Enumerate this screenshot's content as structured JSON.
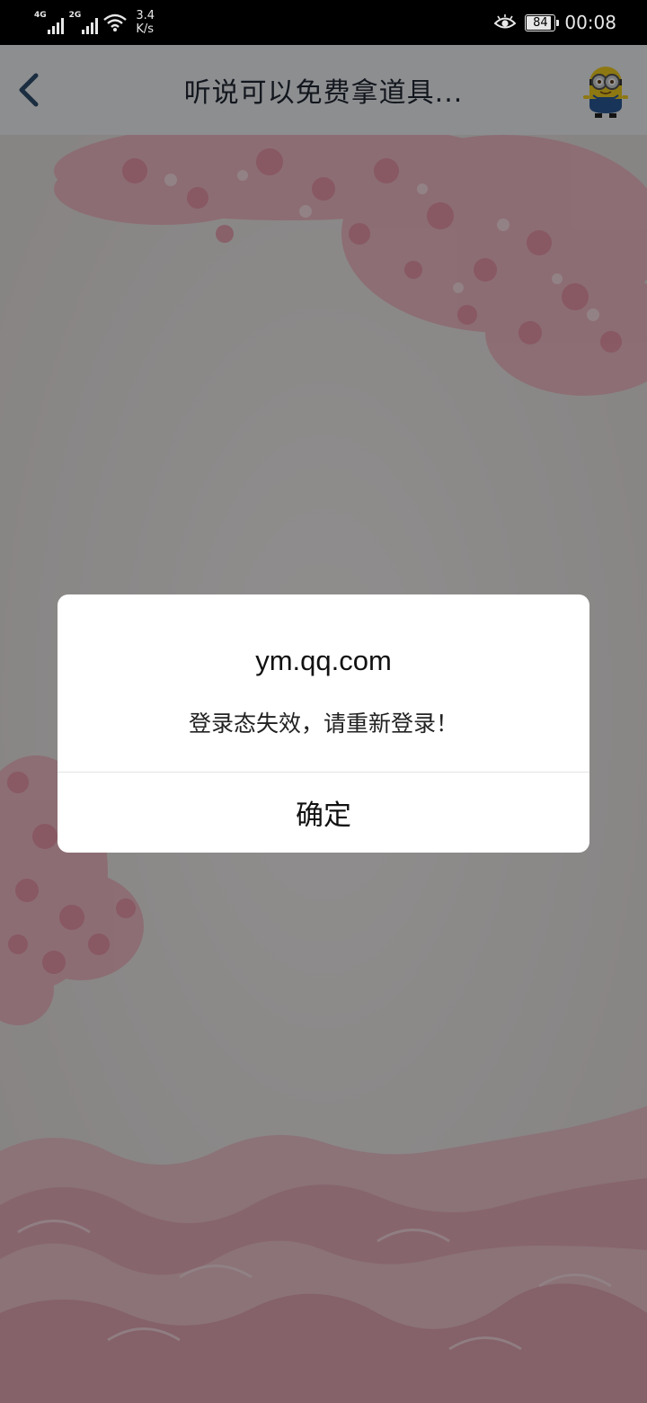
{
  "status_bar": {
    "network1": "4G",
    "network2": "2G",
    "speed_value": "3.4",
    "speed_unit": "K/s",
    "battery": "84",
    "time": "00:08",
    "icons": [
      "signal-4g-icon",
      "signal-2g-icon",
      "wifi-icon",
      "eye-comfort-icon",
      "battery-icon"
    ]
  },
  "nav": {
    "title": "听说可以免费拿道具...",
    "back_icon": "chevron-left-icon",
    "avatar_icon": "minion-avatar-icon"
  },
  "dialog": {
    "title": "ym.qq.com",
    "message": "登录态失效，请重新登录！",
    "confirm_label": "确定"
  },
  "colors": {
    "nav_background": "#f3f5f9",
    "back_arrow": "#2f4f6e",
    "blossom": "#f2b8c4",
    "overlay": "rgba(0,0,0,0.42)"
  }
}
